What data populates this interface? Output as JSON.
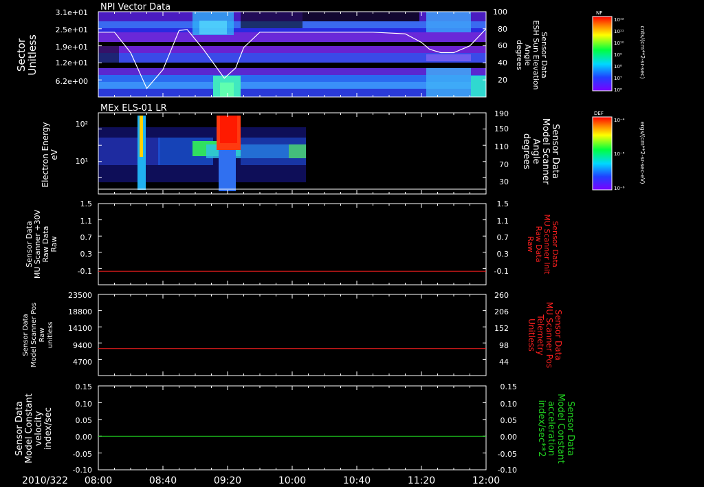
{
  "time_axis": {
    "start_label": "2010/322",
    "ticks": [
      "08:00",
      "08:40",
      "09:20",
      "10:00",
      "10:40",
      "11:20",
      "12:00"
    ],
    "range_minutes": [
      0,
      240
    ]
  },
  "colorbars": [
    {
      "tag": "NF",
      "unit_label": "cnts/(cm**2-sr-sec)",
      "tick_labels": [
        "10¹²",
        "10¹¹",
        "10¹⁰",
        "10⁹",
        "10⁸",
        "10⁷",
        "10⁶"
      ]
    },
    {
      "tag": "DEF",
      "unit_label": "ergs/(cm**2-sr-sec-eV)",
      "tick_labels": [
        "10⁻⁴",
        "10⁻⁵",
        "10⁻⁶"
      ]
    }
  ],
  "chart_data": [
    {
      "type": "heatmap",
      "title": "NPI Vector Data",
      "ylabel": [
        "Sector",
        "Unitless"
      ],
      "y_ticks": [
        "3.1e+01",
        "2.5e+01",
        "1.9e+01",
        "1.2e+01",
        "6.2e+00"
      ],
      "y2label": [
        "Sensor Data",
        "ESH Sun Elevation",
        "Angle",
        "degrees"
      ],
      "y2_ticks": [
        "100",
        "80",
        "60",
        "40",
        "20"
      ],
      "y2lim": [
        0,
        100
      ],
      "overlay_line": {
        "color": "#ffffff",
        "x": [
          0,
          10,
          20,
          30,
          40,
          50,
          55,
          65,
          78,
          85,
          90,
          100,
          110,
          120,
          130,
          150,
          170,
          190,
          200,
          205,
          212,
          220,
          230,
          240
        ],
        "y": [
          76,
          76,
          52,
          10,
          32,
          78,
          79,
          56,
          22,
          34,
          58,
          76,
          76,
          76,
          76,
          76,
          76,
          74,
          64,
          56,
          52,
          52,
          60,
          80
        ]
      }
    },
    {
      "type": "heatmap",
      "title": "MEx ELS-01 LR",
      "ylabel": [
        "Electron Energy",
        "eV"
      ],
      "y_ticks": [
        "10²",
        "10¹"
      ],
      "y2label": [
        "Sensor Data",
        "Model Scanner",
        "Angle",
        "degrees"
      ],
      "y2_ticks": [
        "190",
        "150",
        "110",
        "70",
        "30"
      ],
      "y2lim": [
        10,
        190
      ],
      "overlay_line": {
        "color": "#ffffff",
        "x": [
          0,
          240
        ],
        "y": [
          10,
          10
        ]
      }
    },
    {
      "type": "line",
      "ylabel": [
        "Sensor Data",
        "MU Scanner +30V",
        "Raw Data",
        "Raw"
      ],
      "y_ticks": [
        "1.5",
        "1.1",
        "0.7",
        "0.3",
        "-0.1"
      ],
      "y2label": [
        "Sensor Data",
        "MU Scanner Init",
        "Raw Data",
        "Raw"
      ],
      "y2_ticks": [
        "1.5",
        "1.1",
        "0.7",
        "0.3",
        "-0.1"
      ],
      "ylim": [
        -0.3,
        1.5
      ],
      "series": [
        {
          "color": "#ff2020",
          "x": [
            0,
            240
          ],
          "y": [
            0.0,
            0.0
          ]
        }
      ]
    },
    {
      "type": "line",
      "ylabel": [
        "Sensor Data",
        "Model Scanner Pos",
        "Raw",
        "unitless"
      ],
      "y_ticks": [
        "23500",
        "18800",
        "14100",
        "9400",
        "4700"
      ],
      "y2label": [
        "Sensor Data",
        "MU Scanner Pos",
        "Telemetry",
        "Unitless"
      ],
      "y2_ticks": [
        "260",
        "206",
        "152",
        "98",
        "44"
      ],
      "ylim": [
        0,
        23500
      ],
      "series": [
        {
          "color": "#ff2020",
          "x": [
            0,
            240
          ],
          "y": [
            7800,
            7800
          ]
        }
      ]
    },
    {
      "type": "line",
      "ylabel": [
        "Sensor Data",
        "Model Constant",
        "velocity",
        "index/sec"
      ],
      "y_ticks": [
        "0.15",
        "0.10",
        "0.05",
        "0.00",
        "-0.05",
        "-0.10"
      ],
      "y2label": [
        "Sensor Data",
        "Model Constant",
        "acceleration",
        "index/sec**2"
      ],
      "y2_ticks": [
        "0.15",
        "0.10",
        "0.05",
        "0.00",
        "-0.05",
        "-0.10"
      ],
      "ylim": [
        -0.1,
        0.15
      ],
      "series": [
        {
          "color": "#20d020",
          "x": [
            0,
            240
          ],
          "y": [
            0.0,
            0.0
          ]
        }
      ]
    }
  ]
}
